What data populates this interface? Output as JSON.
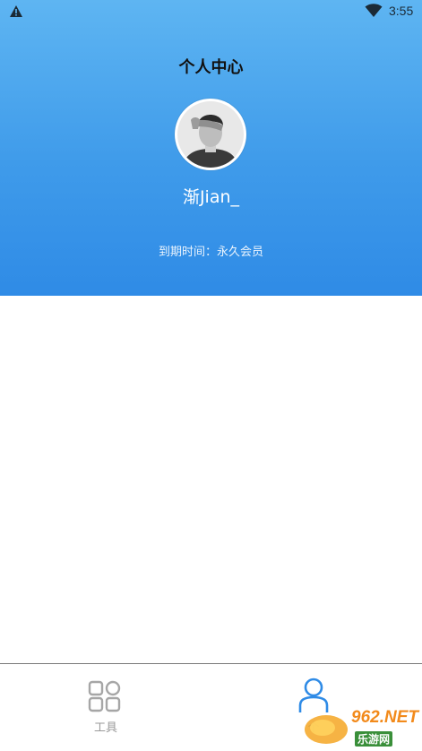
{
  "status_bar": {
    "time": "3:55"
  },
  "header": {
    "title": "个人中心",
    "username": "渐Jian_",
    "expiry": "到期时间：永久会员"
  },
  "nav": {
    "tools_label": "工具",
    "me_label": "个"
  },
  "watermark": {
    "main": "962.NET",
    "sub": "乐游网"
  },
  "colors": {
    "accent": "#2f8be6",
    "header_top": "#5eb5f2",
    "header_bottom": "#2f8be6"
  }
}
